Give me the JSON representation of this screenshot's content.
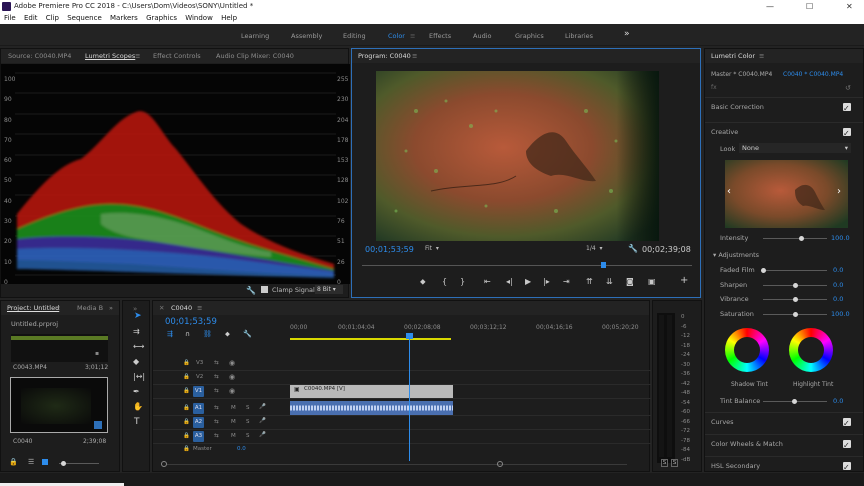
{
  "window": {
    "title": "Adobe Premiere Pro CC 2018 - C:\\Users\\Dom\\Videos\\SONY\\Untitled *",
    "minimize": "—",
    "maximize": "☐",
    "close": "✕"
  },
  "menu": [
    "File",
    "Edit",
    "Clip",
    "Sequence",
    "Markers",
    "Graphics",
    "Window",
    "Help"
  ],
  "workspaces": [
    {
      "label": "Learning",
      "active": false
    },
    {
      "label": "Assembly",
      "active": false
    },
    {
      "label": "Editing",
      "active": false
    },
    {
      "label": "Color",
      "active": true
    },
    {
      "label": "Effects",
      "active": false
    },
    {
      "label": "Audio",
      "active": false
    },
    {
      "label": "Graphics",
      "active": false
    },
    {
      "label": "Libraries",
      "active": false
    }
  ],
  "workspace_more": "»",
  "source_panel": {
    "tabs": [
      "Source: C0040.MP4",
      "Lumetri Scopes",
      "Effect Controls",
      "Audio Clip Mixer: C0040"
    ],
    "active_tab": "Lumetri Scopes",
    "left_scale": [
      "100",
      "90",
      "80",
      "70",
      "60",
      "50",
      "40",
      "30",
      "20",
      "10",
      "0"
    ],
    "right_scale": [
      "255",
      "230",
      "204",
      "178",
      "153",
      "128",
      "102",
      "76",
      "51",
      "26",
      "0"
    ],
    "clamp_signal": "Clamp Signal",
    "bit_depth": "8 Bit"
  },
  "program": {
    "title": "Program: C0040",
    "timecode": "00;01;53;59",
    "fit": "Fit",
    "resolution": "1/4",
    "duration": "00;02;39;08",
    "playhead_fraction": 0.73
  },
  "project": {
    "tabs": [
      "Project: Untitled",
      "Media B"
    ],
    "file": "Untitled.prproj",
    "clip1_name": "C0043.MP4",
    "clip1_dur": "3;01;12",
    "clip2_name": "C0040",
    "clip2_dur": "2;39;08"
  },
  "timeline": {
    "tab": "C0040",
    "timecode": "00;01;53;59",
    "ruler": [
      "00;00",
      "00;01;04;04",
      "00;02;08;08",
      "00;03;12;12",
      "00;04;16;16",
      "00;05;20;20"
    ],
    "video_tracks": [
      "V3",
      "V2",
      "V1"
    ],
    "audio_tracks": [
      "A1",
      "A2",
      "A3"
    ],
    "master_label": "Master",
    "master_value": "0.0",
    "clip_label": "C0040.MP4 [V]",
    "playhead_fraction": 0.337
  },
  "audio_meter": {
    "scale": [
      "0",
      "-6",
      "-12",
      "-18",
      "-24",
      "-30",
      "-36",
      "-42",
      "-48",
      "-54",
      "-60",
      "-66",
      "-72",
      "-78",
      "-84",
      "-dB"
    ],
    "solo": [
      "S",
      "S"
    ]
  },
  "lumetri": {
    "title": "Lumetri Color",
    "source": "Master * C0040.MP4",
    "sequence": "C0040 * C0040.MP4",
    "fx": "fx",
    "sections": {
      "basic": "Basic Correction",
      "creative": "Creative",
      "curves": "Curves",
      "wheels": "Color Wheels & Match",
      "hsl": "HSL Secondary"
    },
    "look_label": "Look",
    "look_value": "None",
    "intensity_label": "Intensity",
    "intensity_value": "100.0",
    "intensity": 1.0,
    "adjustments": "Adjustments",
    "faded_film": {
      "label": "Faded Film",
      "value": "0.0",
      "level": 0.0
    },
    "sharpen": {
      "label": "Sharpen",
      "value": "0.0",
      "level": 0.5
    },
    "vibrance": {
      "label": "Vibrance",
      "value": "0.0",
      "level": 0.5
    },
    "saturation": {
      "label": "Saturation",
      "value": "100.0",
      "level": 0.5
    },
    "shadow_tint": "Shadow Tint",
    "highlight_tint": "Highlight Tint",
    "tint_balance": "Tint Balance",
    "tint_balance_value": "0.0"
  },
  "colors": {
    "accent": "#2d8ceb",
    "panel": "#1d1d1d",
    "clip_video": "#b9b9b9",
    "clip_audio": "#4a6fb0",
    "work_area": "#d8d800"
  }
}
